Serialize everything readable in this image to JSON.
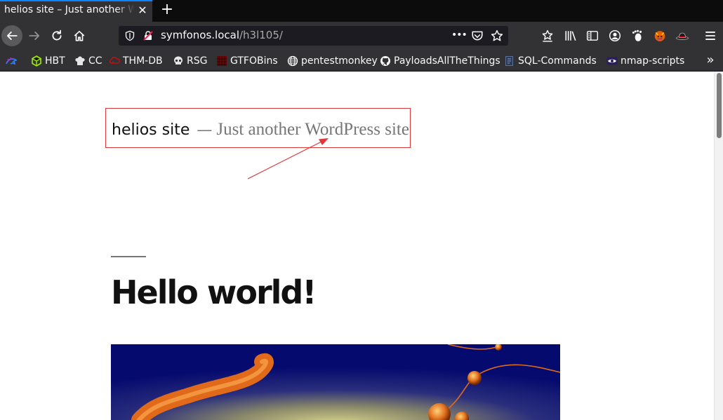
{
  "browser": {
    "tab_title": "helios site – Just another WordPress site",
    "tab_close": "✕",
    "new_tab": "+",
    "url_host": "symfonos.local",
    "url_path": "/h3l105/",
    "url_more": "•••",
    "bookmarks_more": "»"
  },
  "bookmarks": [
    {
      "label": "",
      "icon": "kali-dragon-icon"
    },
    {
      "label": "HBT",
      "icon": "hbt-cube-icon"
    },
    {
      "label": "CC",
      "icon": "chef-hat-icon"
    },
    {
      "label": "THM-DB",
      "icon": "thm-icon"
    },
    {
      "label": "RSG",
      "icon": "skull-icon"
    },
    {
      "label": "GTFOBins",
      "icon": "gtfobins-icon"
    },
    {
      "label": "pentestmonkey",
      "icon": "globe-icon"
    },
    {
      "label": "PayloadsAllTheThings",
      "icon": "github-icon"
    },
    {
      "label": "SQL-Commands",
      "icon": "sql-doc-icon"
    },
    {
      "label": "nmap-scripts",
      "icon": "eye-icon"
    }
  ],
  "page": {
    "site_title": "helios site",
    "site_sep": "—",
    "site_description": "Just another WordPress site",
    "post_title": "Hello world!"
  },
  "colors": {
    "chrome_dark": "#0c0c0d",
    "chrome": "#323234",
    "accent": "#0a84ff",
    "annotation_red": "#e0393b"
  }
}
